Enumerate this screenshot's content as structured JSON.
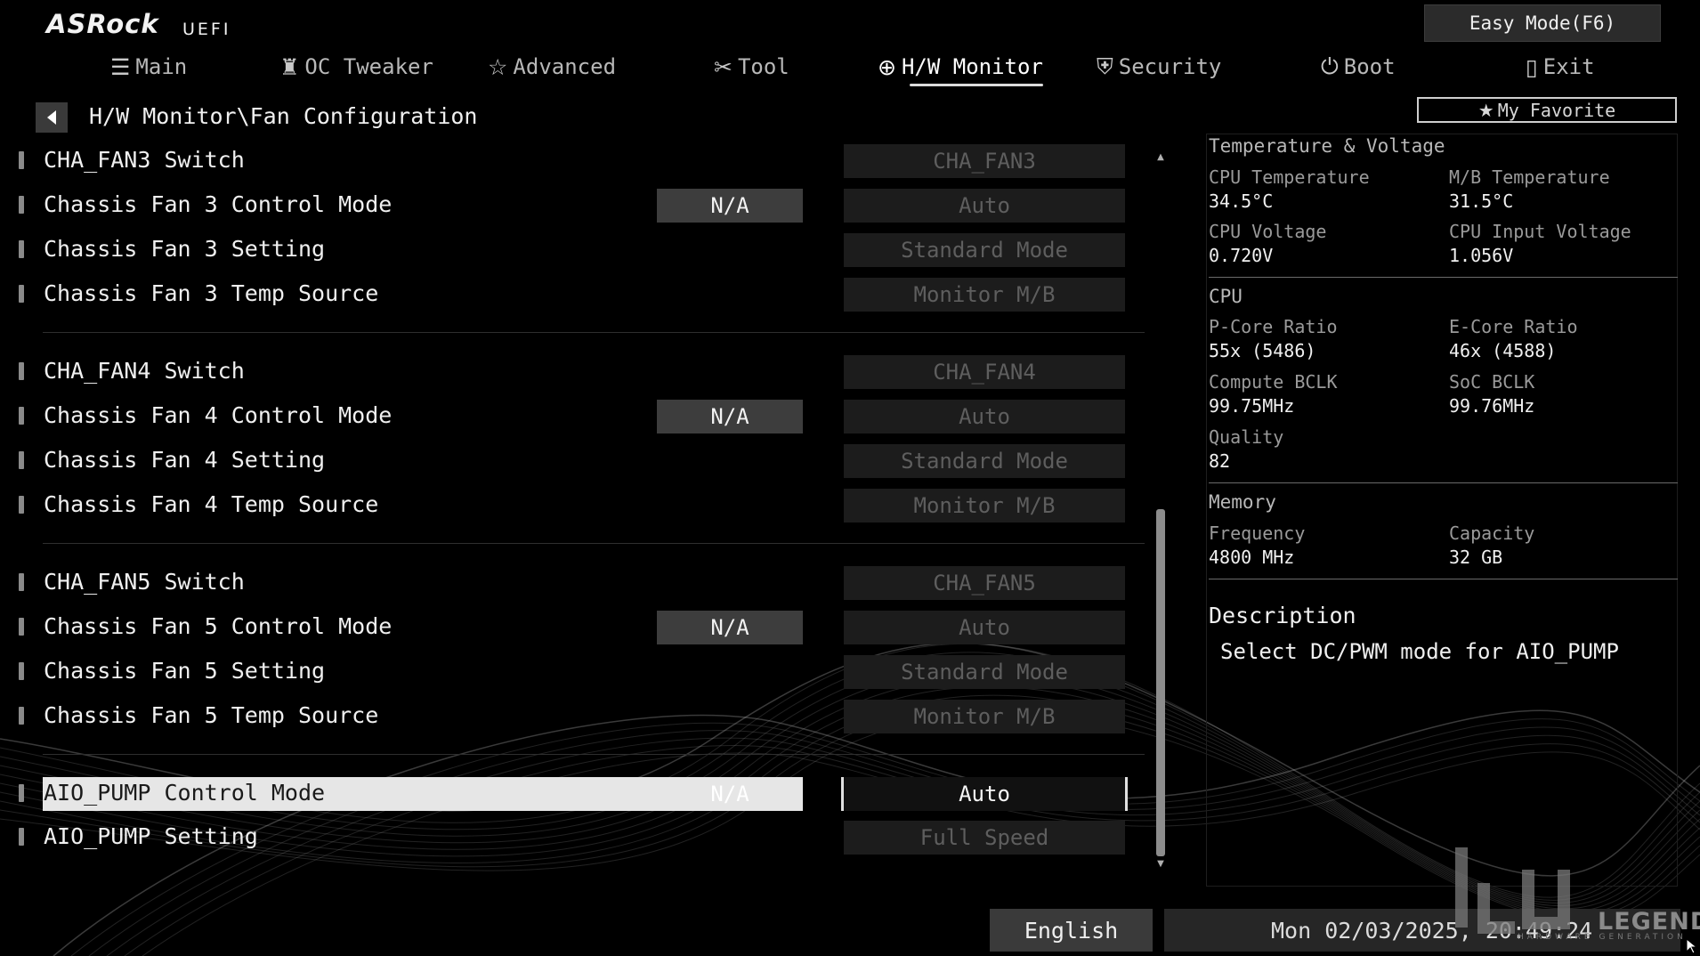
{
  "header": {
    "brand": "ASRock",
    "brand_sub": "UEFI",
    "easy_mode_label": "Easy Mode(F6)",
    "tabs": [
      {
        "label": "Main",
        "icon": "list-icon"
      },
      {
        "label": "OC Tweaker",
        "icon": "rocket-icon"
      },
      {
        "label": "Advanced",
        "icon": "star-icon"
      },
      {
        "label": "Tool",
        "icon": "tools-icon"
      },
      {
        "label": "H/W Monitor",
        "icon": "monitor-icon"
      },
      {
        "label": "Security",
        "icon": "shield-icon"
      },
      {
        "label": "Boot",
        "icon": "power-icon"
      },
      {
        "label": "Exit",
        "icon": "exit-door-icon"
      }
    ],
    "active_tab": "H/W Monitor"
  },
  "breadcrumb": "H/W Monitor\\Fan Configuration",
  "favorite_label": "My Favorite",
  "settings": [
    {
      "label": "CHA_FAN3 Switch",
      "na": "",
      "value": "CHA_FAN3"
    },
    {
      "label": "Chassis Fan 3 Control Mode",
      "na": "N/A",
      "value": "Auto"
    },
    {
      "label": "Chassis Fan 3 Setting",
      "na": "",
      "value": "Standard Mode"
    },
    {
      "label": "Chassis Fan 3 Temp Source",
      "na": "",
      "value": "Monitor M/B"
    },
    {
      "label": "CHA_FAN4 Switch",
      "na": "",
      "value": "CHA_FAN4"
    },
    {
      "label": "Chassis Fan 4 Control Mode",
      "na": "N/A",
      "value": "Auto"
    },
    {
      "label": "Chassis Fan 4 Setting",
      "na": "",
      "value": "Standard Mode"
    },
    {
      "label": "Chassis Fan 4 Temp Source",
      "na": "",
      "value": "Monitor M/B"
    },
    {
      "label": "CHA_FAN5 Switch",
      "na": "",
      "value": "CHA_FAN5"
    },
    {
      "label": "Chassis Fan 5 Control Mode",
      "na": "N/A",
      "value": "Auto"
    },
    {
      "label": "Chassis Fan 5 Setting",
      "na": "",
      "value": "Standard Mode"
    },
    {
      "label": "Chassis Fan 5 Temp Source",
      "na": "",
      "value": "Monitor M/B"
    },
    {
      "label": "AIO_PUMP Control Mode",
      "na": "N/A",
      "value": "Auto",
      "selected": true
    },
    {
      "label": "AIO_PUMP Setting",
      "na": "",
      "value": "Full Speed"
    }
  ],
  "panel": {
    "tv_title": "Temperature & Voltage",
    "cpu_temp_label": "CPU Temperature",
    "cpu_temp": "34.5°C",
    "mb_temp_label": "M/B Temperature",
    "mb_temp": "31.5°C",
    "cpu_volt_label": "CPU Voltage",
    "cpu_volt": "0.720V",
    "cpu_in_volt_label": "CPU Input Voltage",
    "cpu_in_volt": "1.056V",
    "cpu_title": "CPU",
    "pcore_label": "P-Core Ratio",
    "pcore": "55x (5486)",
    "ecore_label": "E-Core Ratio",
    "ecore": "46x (4588)",
    "bclk_label": "Compute BCLK",
    "bclk": "99.75MHz",
    "soc_label": "SoC BCLK",
    "soc": "99.76MHz",
    "quality_label": "Quality",
    "quality": "82",
    "mem_title": "Memory",
    "freq_label": "Frequency",
    "freq": "4800 MHz",
    "cap_label": "Capacity",
    "cap": "32 GB",
    "desc_title": "Description",
    "desc_text": "Select DC/PWM mode for AIO_PUMP"
  },
  "footer": {
    "language": "English",
    "datetime": "Mon 02/03/2025, 20:49:24",
    "watermark": "LEGEND",
    "watermark_sub": "HARDWARE GENERATION"
  },
  "scroll": {
    "position_fraction": 0.5,
    "visible_fraction": 0.5
  },
  "colors": {
    "background": "#000000",
    "selected_row": "#e6e6e6",
    "value_box": "#1c1c1c",
    "na_box": "#3d3d3d"
  }
}
